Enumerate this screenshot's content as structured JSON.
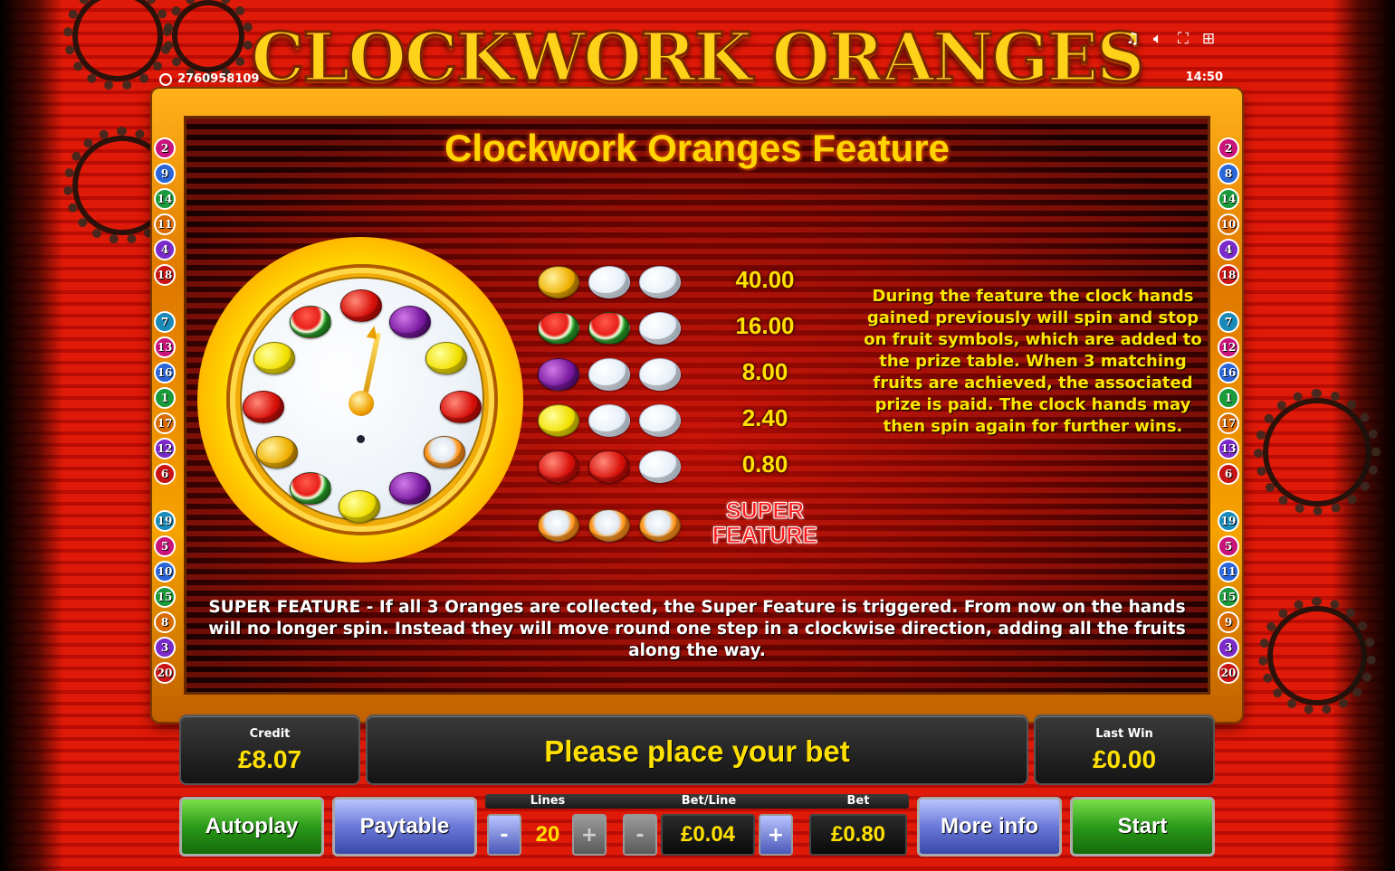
{
  "header": {
    "logo": "CLOCKWORK ORANGES",
    "ticket_id": "2760958109",
    "time": "14:50",
    "icons": [
      "music-icon",
      "sound-icon",
      "fullscreen-icon",
      "settings-icon"
    ]
  },
  "feature": {
    "title": "Clockwork Oranges Feature",
    "description": "During the feature the clock hands gained previously will spin and stop on fruit symbols, which are added to the prize table. When 3 matching fruits are achieved, the associated prize is paid. The clock hands may then spin again for further wins.",
    "super_description": "SUPER FEATURE - If all 3 Oranges are collected, the Super Feature is triggered. From now on the hands will no longer spin. Instead they will move round one step in a clockwise direction, adding all the fruits along the way.",
    "prizes": [
      {
        "symbol": "bell",
        "value": "40.00"
      },
      {
        "symbol": "watermelon",
        "value": "16.00"
      },
      {
        "symbol": "plum",
        "value": "8.00"
      },
      {
        "symbol": "lemon",
        "value": "2.40"
      },
      {
        "symbol": "cherry",
        "value": "0.80"
      },
      {
        "symbol": "orange",
        "value": "SUPER FEATURE"
      }
    ],
    "super_line1": "SUPER",
    "super_line2": "FEATURE"
  },
  "side_numbers": {
    "left": [
      "2",
      "9",
      "14",
      "11",
      "4",
      "18",
      "7",
      "13",
      "16",
      "1",
      "17",
      "12",
      "6",
      "19",
      "5",
      "10",
      "15",
      "8",
      "3",
      "20"
    ],
    "right": [
      "2",
      "8",
      "14",
      "10",
      "4",
      "18",
      "7",
      "12",
      "16",
      "1",
      "17",
      "13",
      "6",
      "19",
      "5",
      "11",
      "15",
      "9",
      "3",
      "20"
    ]
  },
  "status": {
    "credit_label": "Credit",
    "credit_value": "£8.07",
    "message": "Please place your bet",
    "last_win_label": "Last Win",
    "last_win_value": "£0.00"
  },
  "controls": {
    "autoplay": "Autoplay",
    "paytable": "Paytable",
    "lines_label": "Lines",
    "lines_value": "20",
    "betline_label": "Bet/Line",
    "betline_value": "£0.04",
    "bet_label": "Bet",
    "bet_value": "£0.80",
    "minus": "-",
    "plus": "+",
    "more_info": "More info",
    "start": "Start"
  },
  "colors": {
    "accent_yellow": "#ffe000",
    "super_red": "#ff1a1a",
    "background_red": "#e01a08"
  }
}
